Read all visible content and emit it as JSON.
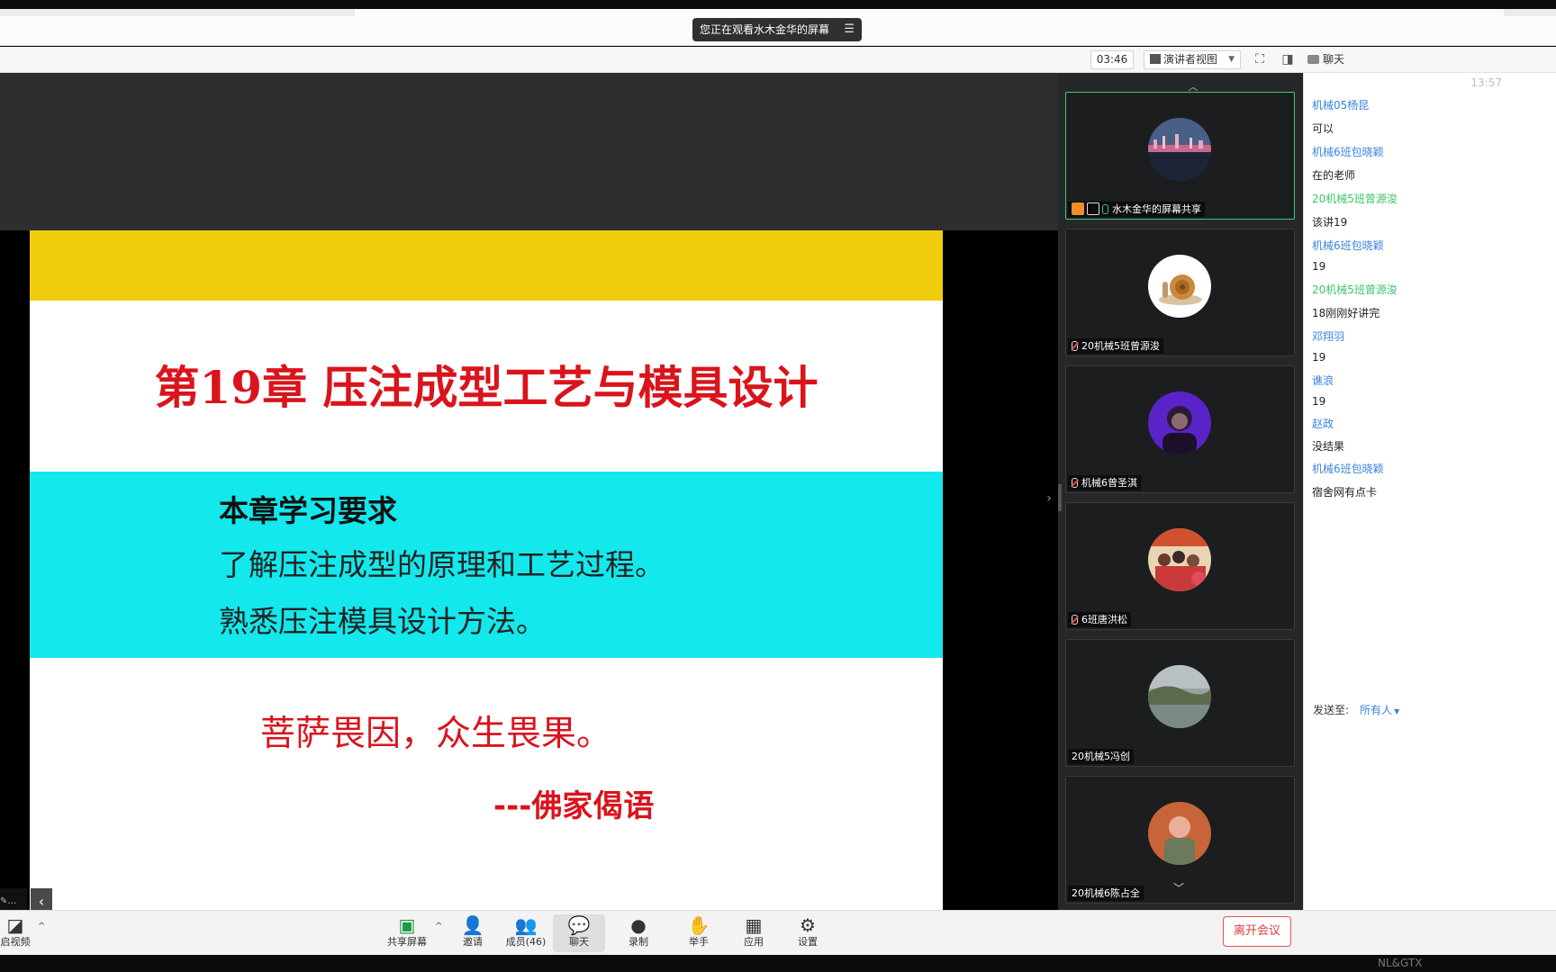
{
  "banner": {
    "text": "您正在观看水木金华的屏幕"
  },
  "toolbar": {
    "timer": "03:46",
    "view_mode": "演讲者视图",
    "chat_label": "聊天"
  },
  "slide": {
    "title": "第19章  压注成型工艺与模具设计",
    "req_title": "本章学习要求",
    "req_lines": [
      "了解压注成型的原理和工艺过程。",
      "熟悉压注模具设计方法。"
    ],
    "quote": "菩萨畏因，众生畏果。",
    "quote_source": "---佛家偈语",
    "colors": {
      "band_top": "#f2cd0d",
      "band_mid": "#13e8ec",
      "red": "#d9141c"
    }
  },
  "participants": [
    {
      "name": "水木金华的屏幕共享",
      "icon": "city-night-avatar",
      "mic": "on",
      "active": true
    },
    {
      "name": "20机械5班曾源浚",
      "icon": "snail-avatar",
      "mic": "muted"
    },
    {
      "name": "机械6曾圣淇",
      "icon": "person-purple-avatar",
      "mic": "muted"
    },
    {
      "name": "6班唐洪松",
      "icon": "crowd-photo-avatar",
      "mic": "muted"
    },
    {
      "name": "20机械5冯创",
      "icon": "landscape-avatar",
      "mic": "none"
    },
    {
      "name": "20机械6陈占全",
      "icon": "person-orange-avatar",
      "mic": "none"
    }
  ],
  "chat": {
    "time": "13:57",
    "messages": [
      {
        "sender": "机械05杨昆",
        "text": "可以",
        "color": "blue"
      },
      {
        "sender": "机械6班包晓颖",
        "text": "在的老师",
        "color": "blue"
      },
      {
        "sender": "20机械5班曾源浚",
        "text": "该讲19",
        "color": "green"
      },
      {
        "sender": "机械6班包晓颖",
        "text": "19",
        "color": "blue"
      },
      {
        "sender": "20机械5班曾源浚",
        "text": "18刚刚好讲完",
        "color": "green"
      },
      {
        "sender": "邓翔羽",
        "text": "19",
        "color": "blue"
      },
      {
        "sender": "谯浪",
        "text": "19",
        "color": "blue"
      },
      {
        "sender": "赵政",
        "text": "没结果",
        "color": "blue"
      },
      {
        "sender": "机械6班包晓颖",
        "text": "宿舍网有点卡",
        "color": "blue"
      }
    ],
    "send_to_label": "发送至:",
    "send_to_target": "所有人"
  },
  "bottom_bar": {
    "video": "启视频",
    "share": "共享屏幕",
    "invite": "邀请",
    "members": "成员(46)",
    "chat": "聊天",
    "record": "录制",
    "raise_hand": "举手",
    "apps": "应用",
    "settings": "设置",
    "leave": "离开会议"
  },
  "taskbar_corner": "NL&GTX"
}
